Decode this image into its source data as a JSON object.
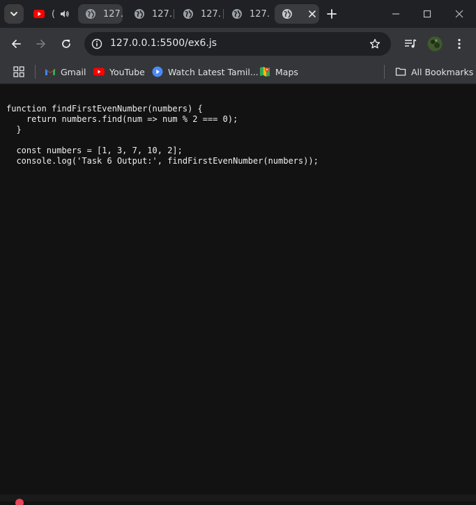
{
  "tabs": [
    {
      "title": "(",
      "favicon": "youtube-icon",
      "audio": "speaker-icon"
    },
    {
      "title": "127.",
      "favicon": "globe-icon"
    },
    {
      "title": "127.",
      "favicon": "globe-icon"
    },
    {
      "title": "127.",
      "favicon": "globe-icon"
    },
    {
      "title": "127.",
      "favicon": "globe-icon"
    },
    {
      "title": "",
      "favicon": "globe-icon",
      "active": true
    }
  ],
  "address": {
    "url": "127.0.0.1:5500/ex6.js"
  },
  "bookmarks": [
    {
      "label": "Gmail",
      "icon": "gmail-icon"
    },
    {
      "label": "YouTube",
      "icon": "youtube-icon"
    },
    {
      "label": "Watch Latest Tamil...",
      "icon": "play-circle-icon"
    },
    {
      "label": "Maps",
      "icon": "maps-icon"
    }
  ],
  "all_bookmarks": "All Bookmarks",
  "code": "function findFirstEvenNumber(numbers) {\n    return numbers.find(num => num % 2 === 0);\n  }\n\n  const numbers = [1, 3, 7, 10, 2];\n  console.log('Task 6 Output:', findFirstEvenNumber(numbers));",
  "colors": {
    "accent_youtube": "#ff0000",
    "tab_bg": "#202124",
    "toolbar_bg": "#35363a",
    "page_bg": "#121212"
  }
}
